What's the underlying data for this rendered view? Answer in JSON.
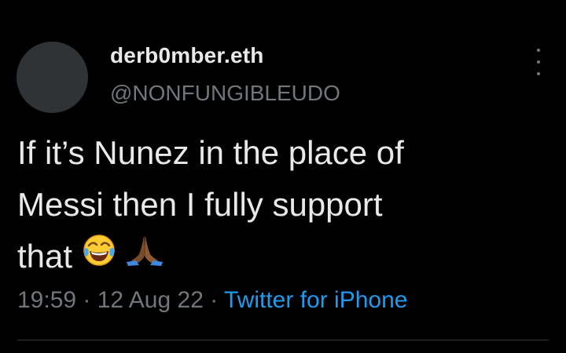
{
  "author": {
    "display_name": "derb0mber.eth",
    "handle": "@NONFUNGIBLEUDO"
  },
  "tweet": {
    "text_line1": "If it’s Nunez in the place of",
    "text_line2": "Messi then I fully support",
    "text_line3": "that",
    "emojis": [
      "tears-of-joy-emoji",
      "folded-hands-emoji"
    ]
  },
  "meta": {
    "time": "19:59",
    "separator": " · ",
    "date": "12 Aug 22",
    "source": "Twitter for iPhone"
  },
  "colors": {
    "background": "#000000",
    "text": "#e7e9ea",
    "secondary": "#71767b",
    "link": "#1d9bf0"
  }
}
